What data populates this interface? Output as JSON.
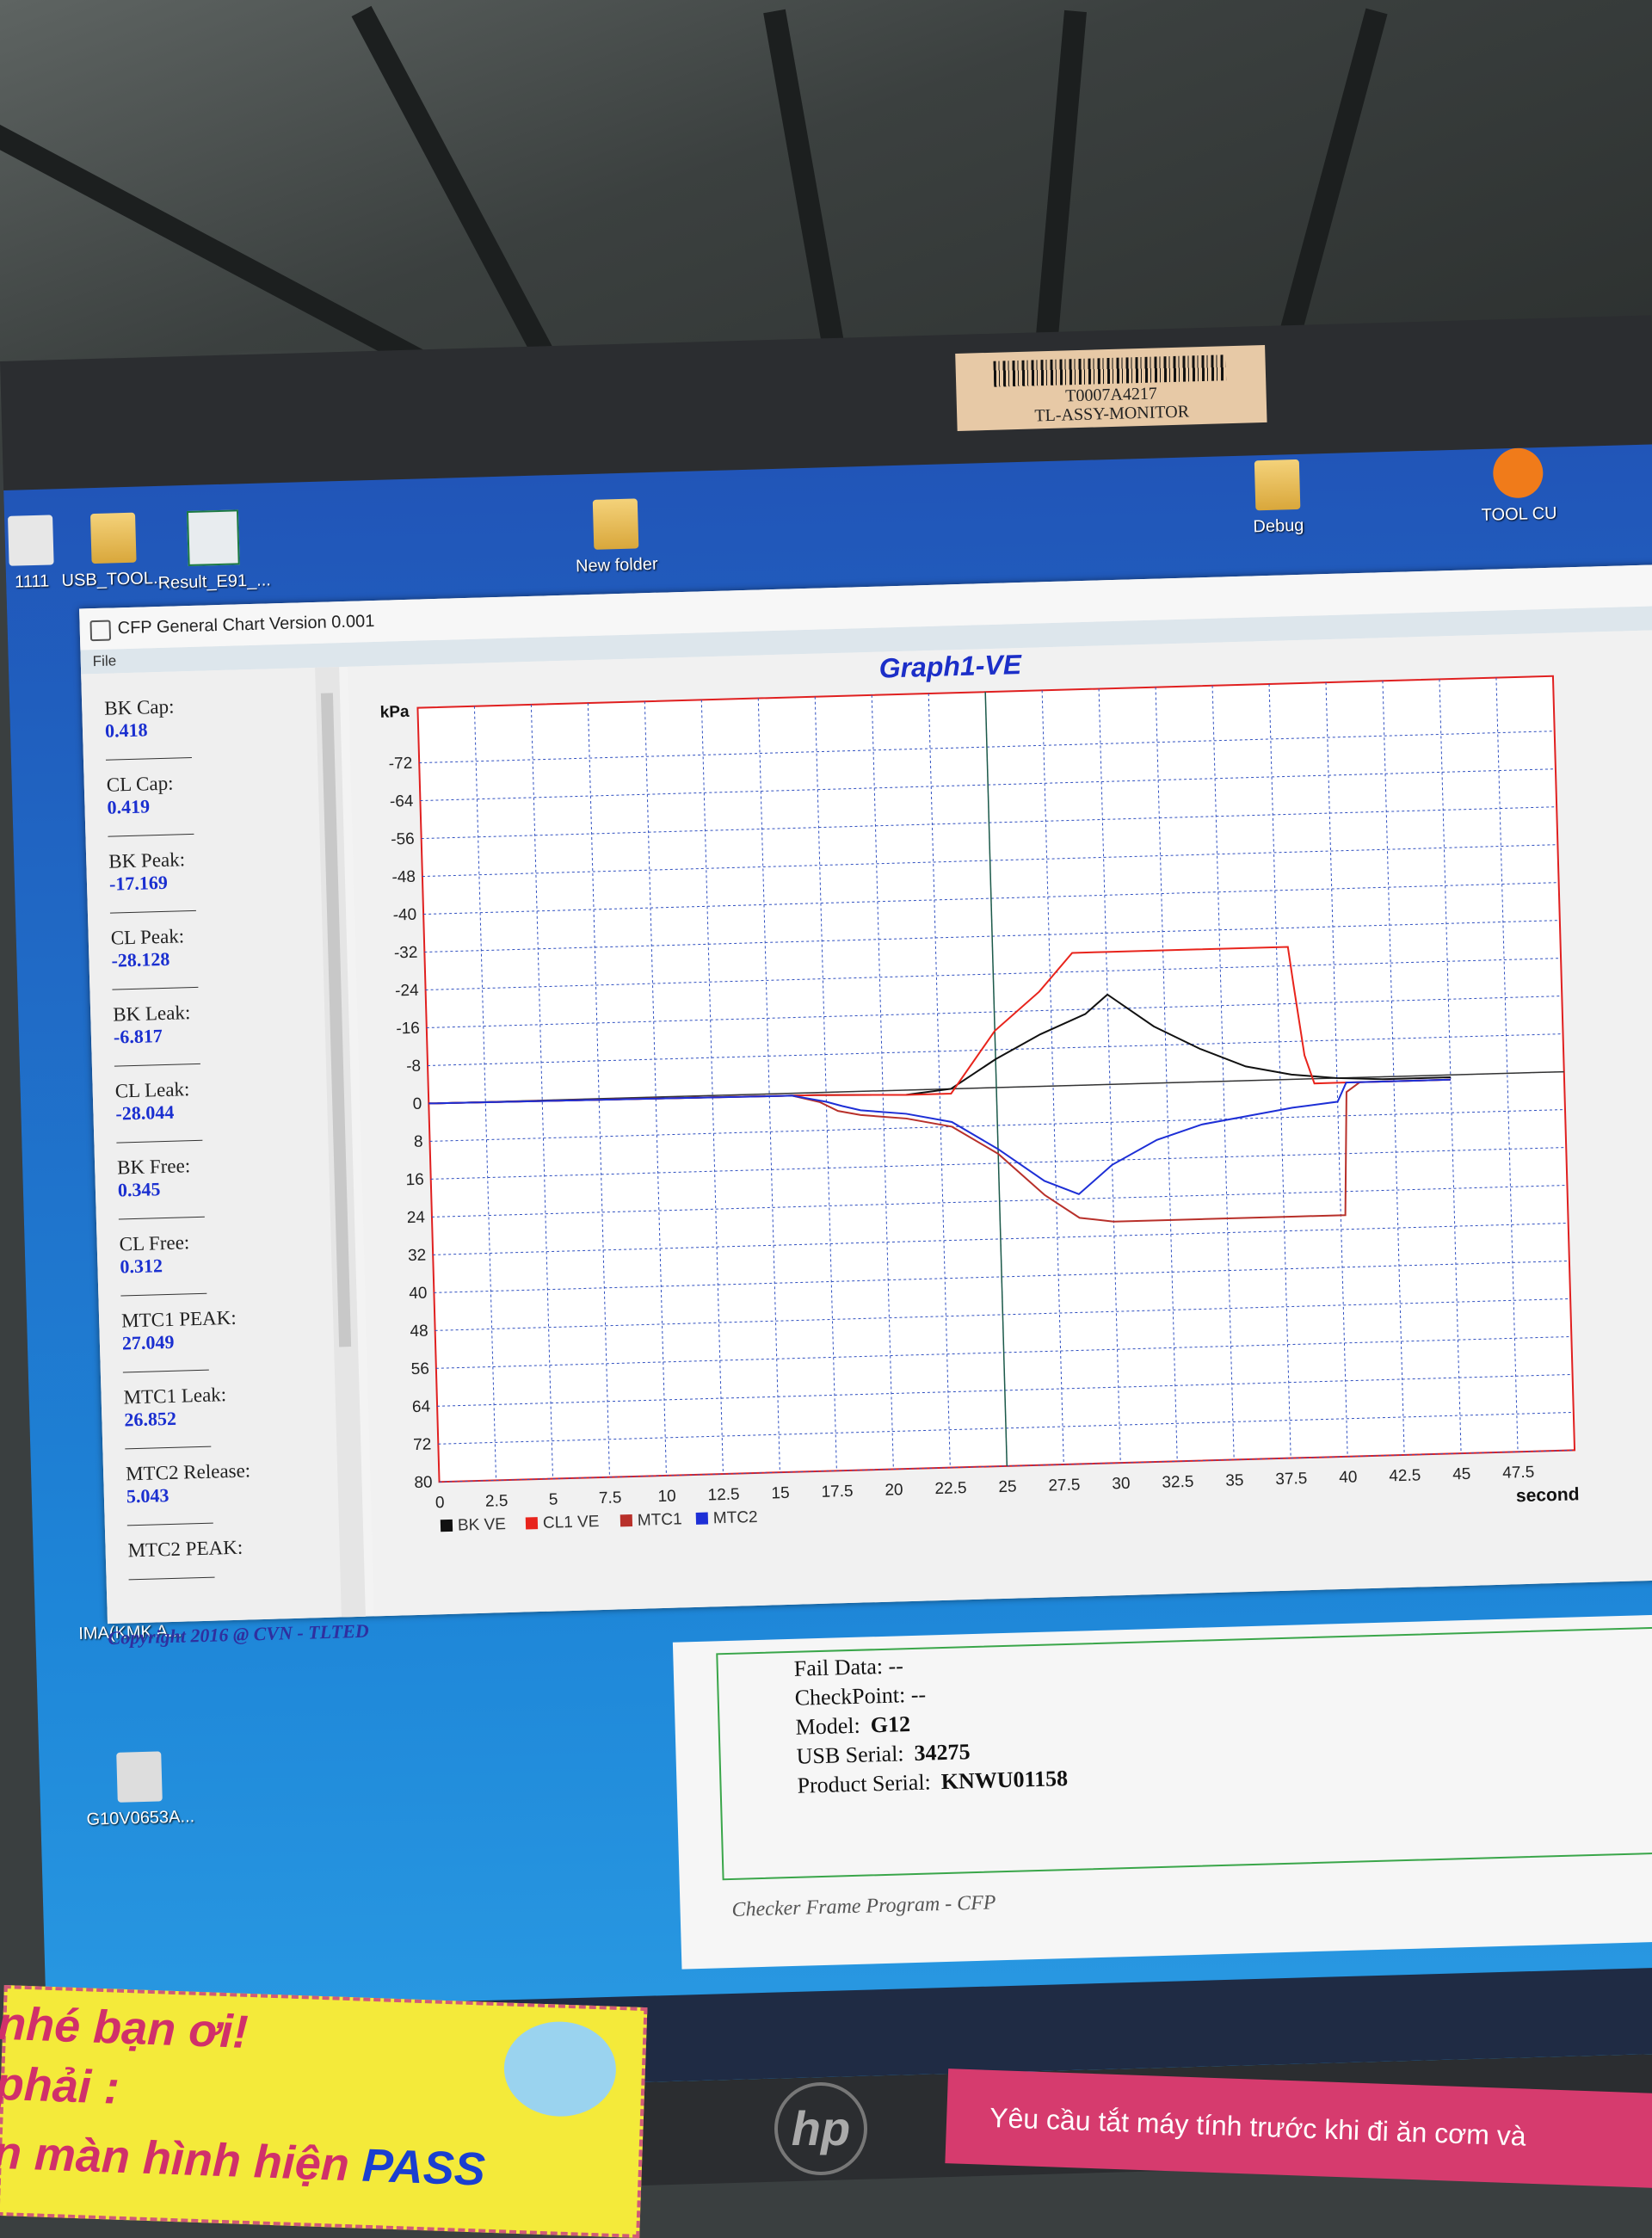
{
  "asset_tag": {
    "line1": "T0007A4217",
    "line2": "TL-ASSY-MONITOR"
  },
  "desktop_icons": [
    {
      "label": "1111"
    },
    {
      "label": "USB_TOOL..."
    },
    {
      "label": "Result_E91_..."
    },
    {
      "label": "New folder"
    },
    {
      "label": "Debug"
    },
    {
      "label": "TOOL CU"
    },
    {
      "label": "IMA(KMK A..."
    },
    {
      "label": "G10V0653A..."
    }
  ],
  "window": {
    "title": "CFP General Chart Version 0.001",
    "menu": "File"
  },
  "stats": [
    {
      "label": "BK Cap:",
      "value": "0.418"
    },
    {
      "label": "CL Cap:",
      "value": "0.419"
    },
    {
      "label": "BK Peak:",
      "value": "-17.169"
    },
    {
      "label": "CL Peak:",
      "value": "-28.128"
    },
    {
      "label": "BK Leak:",
      "value": "-6.817"
    },
    {
      "label": "CL Leak:",
      "value": "-28.044"
    },
    {
      "label": "BK Free:",
      "value": "0.345"
    },
    {
      "label": "CL Free:",
      "value": "0.312"
    },
    {
      "label": "MTC1 PEAK:",
      "value": "27.049"
    },
    {
      "label": "MTC1 Leak:",
      "value": "26.852"
    },
    {
      "label": "MTC2 Release:",
      "value": "5.043"
    },
    {
      "label": "MTC2 PEAK:",
      "value": ""
    }
  ],
  "copyright": "Copyright 2016 @ CVN - TLTED",
  "lower_info": {
    "fail_data": "Fail Data:  --",
    "checkpoint": "CheckPoint:  --",
    "model_label": "Model:",
    "model": "G12",
    "usb_label": "USB Serial:",
    "usb": "34275",
    "product_label": "Product Serial:",
    "product": "KNWU01158",
    "footer": "Checker Frame Program - CFP"
  },
  "sticker": {
    "line1": "nhé bạn ơi!",
    "line2": "phải :",
    "line3": "n màn hình hiện",
    "pass": "PASS"
  },
  "banner": "Yêu cầu tắt máy tính trước khi đi ăn cơm và",
  "hp_logo": "hp",
  "colors": {
    "bk": "#111111",
    "cl1": "#e8241c",
    "mtc1": "#b8302a",
    "mtc2": "#1d2fd6",
    "title": "#1c2fc8",
    "frame": "#e02020"
  },
  "chart_data": {
    "type": "line",
    "title": "Graph1-VE",
    "xlabel": "second",
    "ylabel": "kPa",
    "x_ticks": [
      "0",
      "2.5",
      "5",
      "7.5",
      "10",
      "12.5",
      "15",
      "17.5",
      "20",
      "22.5",
      "25",
      "27.5",
      "30",
      "32.5",
      "35",
      "37.5",
      "40",
      "42.5",
      "45",
      "47.5"
    ],
    "y_ticks": [
      "-72",
      "-64",
      "-56",
      "-48",
      "-40",
      "-32",
      "-24",
      "-16",
      "-8",
      "0",
      "8",
      "16",
      "24",
      "32",
      "40",
      "48",
      "56",
      "64",
      "72",
      "80"
    ],
    "xlim": [
      0,
      50
    ],
    "ylim": [
      -80,
      80
    ],
    "y_inverted": true,
    "grid": true,
    "legend_position": "bottom-left",
    "series": [
      {
        "name": "BK VE",
        "color": "#111111",
        "x": [
          0,
          17,
          21,
          23,
          25,
          27,
          29,
          30,
          32,
          34,
          36,
          38,
          40,
          42,
          45
        ],
        "y": [
          0,
          0.5,
          1,
          0,
          -6,
          -11,
          -15,
          -19,
          -12,
          -7,
          -3,
          -1,
          0,
          0.5,
          0.5
        ]
      },
      {
        "name": "CL1 VE",
        "color": "#e8241c",
        "x": [
          0,
          17,
          21,
          23,
          25,
          27,
          28.5,
          30,
          34,
          38,
          38.2,
          38.6,
          39,
          40,
          45
        ],
        "y": [
          0,
          0.5,
          1,
          1,
          -12,
          -20,
          -28,
          -28,
          -28,
          -28,
          -20,
          -5,
          1,
          1,
          1
        ]
      },
      {
        "name": "MTC1",
        "color": "#b8302a",
        "x": [
          0,
          16,
          17.2,
          18,
          19,
          21,
          23,
          25,
          27,
          28.5,
          30,
          34,
          38,
          40.2,
          40.4,
          41,
          45
        ],
        "y": [
          0,
          0.5,
          2,
          4,
          5,
          6,
          8,
          14,
          23,
          28,
          29,
          29,
          29,
          29,
          3,
          1,
          1
        ]
      },
      {
        "name": "MTC2",
        "color": "#1d2fd6",
        "x": [
          0,
          16,
          17.5,
          18.2,
          19,
          21,
          23,
          25,
          27,
          28.5,
          30,
          32,
          34,
          36,
          38,
          40,
          40.4,
          45
        ],
        "y": [
          0,
          0.5,
          2,
          3,
          4,
          5,
          7,
          13,
          20,
          23,
          17,
          12,
          9,
          7.5,
          6,
          5,
          1,
          1
        ]
      }
    ]
  }
}
